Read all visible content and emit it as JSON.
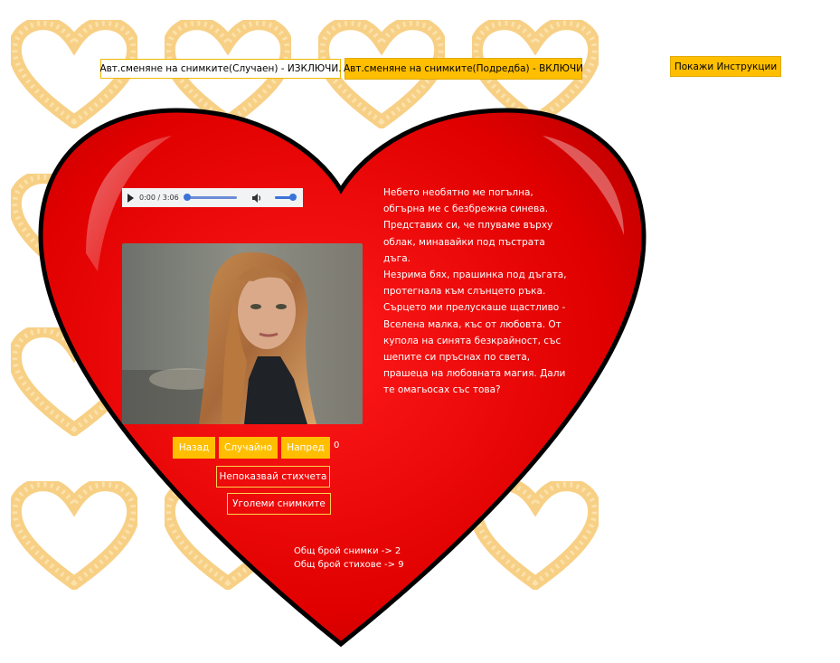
{
  "top_buttons": {
    "random_label": "Авт.сменяне на снимките(Случаен) - ИЗКЛЮЧИ.",
    "ordered_label": "Авт.сменяне на снимките(Подредба) - ВКЛЮЧИ",
    "instructions_label": "Покажи Инструкции"
  },
  "audio_player": {
    "time": "0:00 / 3:06",
    "play_icon": "play-icon",
    "volume_icon": "volume-icon"
  },
  "photo": {
    "icon": "woman-portrait-photo"
  },
  "poem": {
    "lines": [
      "Небето необятно ме погълна,",
      "обгърна ме с безбрежна синева.",
      "Представих си, че плуваме върху",
      "облак, минавайки под пъстрата дъга.",
      "Незрима бях, прашинка под дъгата,",
      "протегнала към слънцето ръка.",
      "Сърцето ми прелускаше щастливо -",
      "Вселена малка, къс от любовта. От",
      "купола на синята безкрайност, със",
      "шепите си пръснах по света,",
      "прашеца на любовната магия. Дали",
      "те омагьосах със това?"
    ]
  },
  "controls": {
    "back_label": "Назад",
    "random_label": "Случайно",
    "next_label": "Напред",
    "counter": "0",
    "hide_poems_label": "Непоказвай стихчета",
    "enlarge_label": "Уголеми снимките"
  },
  "totals": {
    "photos": "Общ брой снимки -> 2",
    "poems": "Общ брой стихове -> 9"
  },
  "colors": {
    "heart_red": "#e60000",
    "button_yellow": "#ffbf00",
    "bg_heart_gold": "#f5c97a"
  }
}
